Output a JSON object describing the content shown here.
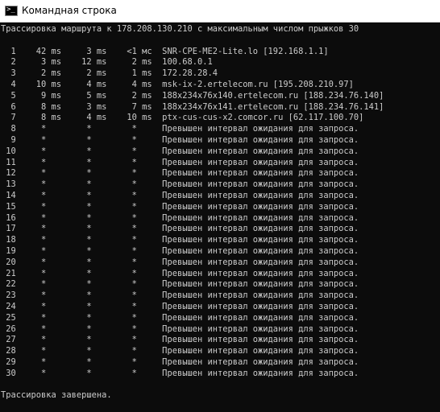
{
  "window": {
    "title": "Командная строка",
    "icon": "cmd-icon",
    "prompt_glyph": ">_"
  },
  "colors": {
    "console_background": "#0c0c0c",
    "console_text": "#cccccc",
    "titlebar_background": "#ffffff"
  },
  "console": {
    "lines": [
      "Трассировка маршрута к 178.208.130.210 с максимальным числом прыжков 30",
      "",
      "  1    42 ms     3 ms    <1 мс  SNR-CPE-ME2-Lite.lo [192.168.1.1]",
      "  2     3 ms    12 ms     2 ms  100.68.0.1",
      "  3     2 ms     2 ms     1 ms  172.28.28.4",
      "  4    10 ms     4 ms     4 ms  msk-ix-2.ertelecom.ru [195.208.210.97]",
      "  5     9 ms     5 ms     2 ms  188x234x76x140.ertelecom.ru [188.234.76.140]",
      "  6     8 ms     3 ms     7 ms  188x234x76x141.ertelecom.ru [188.234.76.141]",
      "  7     8 ms     4 ms    10 ms  ptx-cus-cus-x2.comcor.ru [62.117.100.70]",
      "  8     *        *        *     Превышен интервал ожидания для запроса.",
      "  9     *        *        *     Превышен интервал ожидания для запроса.",
      " 10     *        *        *     Превышен интервал ожидания для запроса.",
      " 11     *        *        *     Превышен интервал ожидания для запроса.",
      " 12     *        *        *     Превышен интервал ожидания для запроса.",
      " 13     *        *        *     Превышен интервал ожидания для запроса.",
      " 14     *        *        *     Превышен интервал ожидания для запроса.",
      " 15     *        *        *     Превышен интервал ожидания для запроса.",
      " 16     *        *        *     Превышен интервал ожидания для запроса.",
      " 17     *        *        *     Превышен интервал ожидания для запроса.",
      " 18     *        *        *     Превышен интервал ожидания для запроса.",
      " 19     *        *        *     Превышен интервал ожидания для запроса.",
      " 20     *        *        *     Превышен интервал ожидания для запроса.",
      " 21     *        *        *     Превышен интервал ожидания для запроса.",
      " 22     *        *        *     Превышен интервал ожидания для запроса.",
      " 23     *        *        *     Превышен интервал ожидания для запроса.",
      " 24     *        *        *     Превышен интервал ожидания для запроса.",
      " 25     *        *        *     Превышен интервал ожидания для запроса.",
      " 26     *        *        *     Превышен интервал ожидания для запроса.",
      " 27     *        *        *     Превышен интервал ожидания для запроса.",
      " 28     *        *        *     Превышен интервал ожидания для запроса.",
      " 29     *        *        *     Превышен интервал ожидания для запроса.",
      " 30     *        *        *     Превышен интервал ожидания для запроса.",
      "",
      "Трассировка завершена."
    ]
  }
}
